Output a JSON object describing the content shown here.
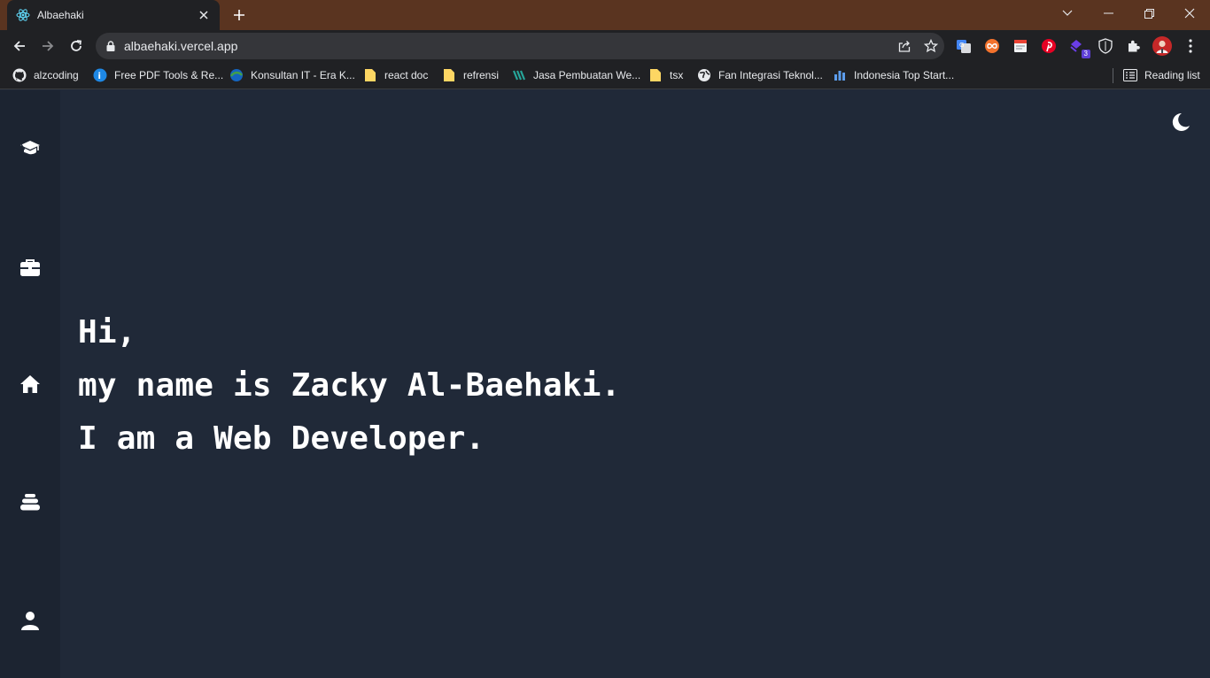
{
  "browser": {
    "tab": {
      "title": "Albaehaki",
      "favicon": "react-icon"
    },
    "new_tab_icon": "plus-icon",
    "window_controls": [
      "chevron-down-icon",
      "minimize-icon",
      "restore-icon",
      "close-icon"
    ],
    "address_bar": {
      "url": "albaehaki.vercel.app",
      "lock_icon": "lock-icon"
    },
    "extension_badge": "3",
    "bookmarks": [
      {
        "label": "alzcoding",
        "icon": "github-icon"
      },
      {
        "label": "Free PDF Tools & Re...",
        "icon": "pdf-tools-icon"
      },
      {
        "label": "Konsultan IT - Era K...",
        "icon": "globe-color-icon"
      },
      {
        "label": "react doc",
        "icon": "folder-icon"
      },
      {
        "label": "refrensi",
        "icon": "folder-icon"
      },
      {
        "label": "Jasa Pembuatan We...",
        "icon": "site-icon"
      },
      {
        "label": "tsx",
        "icon": "folder-icon"
      },
      {
        "label": "Fan Integrasi Teknol...",
        "icon": "globe-icon"
      },
      {
        "label": "Indonesia Top Start...",
        "icon": "bar-chart-icon"
      }
    ],
    "reading_list": "Reading list",
    "colors": {
      "frame": "#5a3420",
      "toolbar": "#202124",
      "omnibox": "#35363a"
    }
  },
  "page": {
    "sidebar": [
      {
        "icon": "graduation-cap-icon",
        "name": "education"
      },
      {
        "icon": "briefcase-icon",
        "name": "experience"
      },
      {
        "icon": "home-icon",
        "name": "home"
      },
      {
        "icon": "layers-icon",
        "name": "stack"
      },
      {
        "icon": "user-icon",
        "name": "about"
      }
    ],
    "theme_toggle_icon": "moon-icon",
    "hero": {
      "line1": "Hi,",
      "line2": "my name is Zacky Al-Baehaki.",
      "line3": "I am a Web Developer."
    },
    "colors": {
      "background": "#202938",
      "sidebar": "#1c2431",
      "text": "#ffffff"
    }
  }
}
